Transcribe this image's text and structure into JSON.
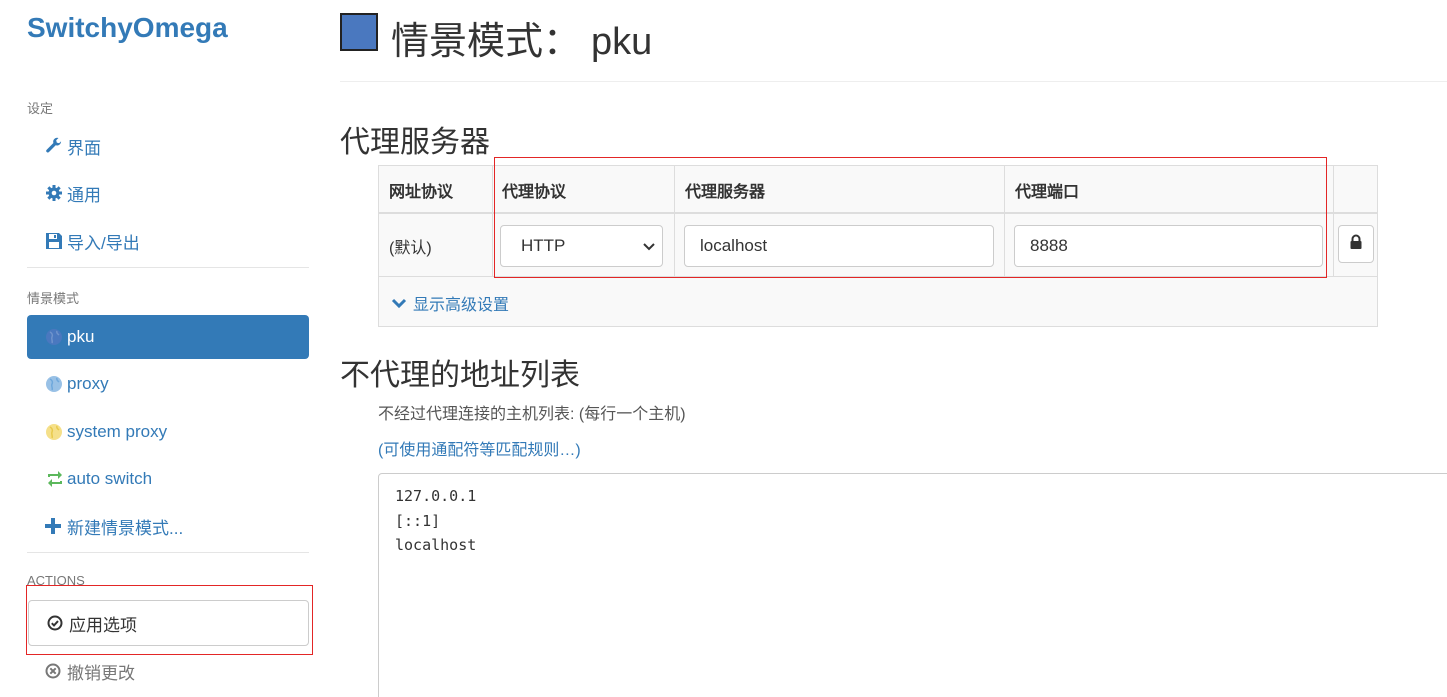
{
  "app": {
    "brand": "SwitchyOmega"
  },
  "sidebar": {
    "settings_header": "设定",
    "settings_items": [
      {
        "label": "界面",
        "icon": "wrench-icon"
      },
      {
        "label": "通用",
        "icon": "gear-icon"
      },
      {
        "label": "导入/导出",
        "icon": "floppy-icon"
      }
    ],
    "profiles_header": "情景模式",
    "profiles": [
      {
        "label": "pku",
        "icon": "globe-icon",
        "active": true
      },
      {
        "label": "proxy",
        "icon": "globe-icon"
      },
      {
        "label": "system proxy",
        "icon": "globe-icon"
      },
      {
        "label": "auto switch",
        "icon": "retweet-icon"
      },
      {
        "label": "新建情景模式...",
        "icon": "plus-icon"
      }
    ],
    "actions_header": "ACTIONS",
    "apply_label": "应用选项",
    "discard_label": "撤销更改"
  },
  "page": {
    "title_prefix": "情景模式：",
    "profile_name": "pku",
    "profile_color": "#4a78bf"
  },
  "proxy_section": {
    "heading": "代理服务器",
    "headers": [
      "网址协议",
      "代理协议",
      "代理服务器",
      "代理端口"
    ],
    "row": {
      "scheme": "(默认)",
      "protocol": "HTTP",
      "server": "localhost",
      "port": "8888"
    },
    "advanced_label": "显示高级设置"
  },
  "bypass_section": {
    "heading": "不代理的地址列表",
    "help": "不经过代理连接的主机列表: (每行一个主机)",
    "wildcard_link": "(可使用通配符等匹配规则…)",
    "list_text": "127.0.0.1\n[::1]\nlocalhost"
  },
  "colors": {
    "accent": "#337ab7",
    "highlight_box": "#e32626"
  }
}
